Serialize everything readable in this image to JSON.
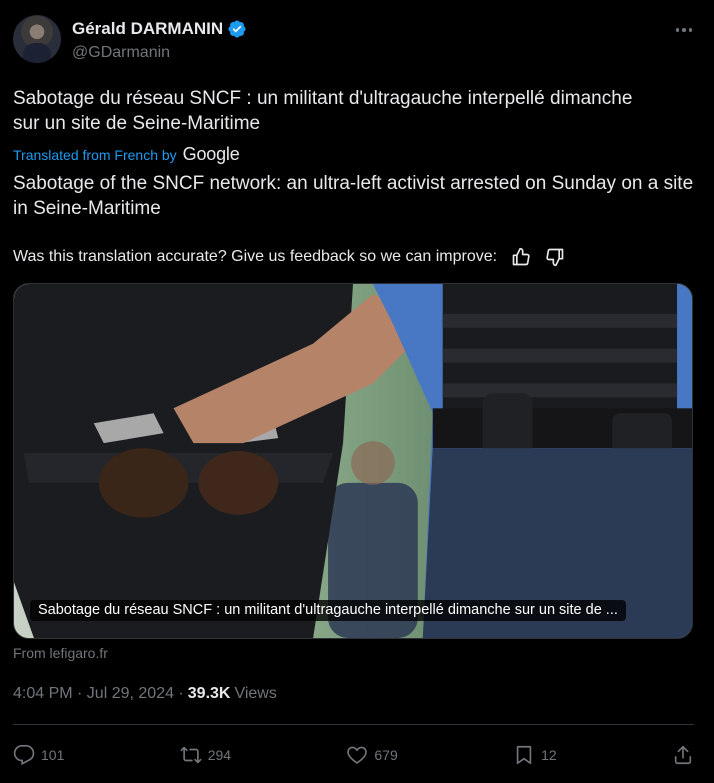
{
  "author": {
    "display_name": "Gérald DARMANIN",
    "handle": "@GDarmanin",
    "verified": true
  },
  "tweet": {
    "text_original": "Sabotage du réseau SNCF : un militant d'ultragauche interpellé dimanche sur un site de Seine-Maritime",
    "translated_from": "Translated from French by",
    "translator": "Google",
    "text_translated": "Sabotage of the SNCF network: an ultra-left activist arrested on Sunday on a site in Seine-Maritime",
    "feedback_prompt": "Was this translation accurate? Give us feedback so we can improve:"
  },
  "card": {
    "caption": "Sabotage du réseau SNCF : un militant d'ultragauche interpellé dimanche sur un site de ...",
    "source": "From lefigaro.fr"
  },
  "meta": {
    "time": "4:04 PM · Jul 29, 2024 · ",
    "views_count": "39.3K",
    "views_label": "Views"
  },
  "actions": {
    "replies": "101",
    "reposts": "294",
    "likes": "679",
    "bookmarks": "12"
  },
  "colors": {
    "background": "#000000",
    "text": "#e7e9ea",
    "muted": "#71767b",
    "accent": "#1d9bf0",
    "divider": "#2f3336"
  },
  "icons": [
    "verified-badge-icon",
    "more-icon",
    "thumbs-up-icon",
    "thumbs-down-icon",
    "reply-icon",
    "repost-icon",
    "like-icon",
    "bookmark-icon",
    "share-icon"
  ]
}
